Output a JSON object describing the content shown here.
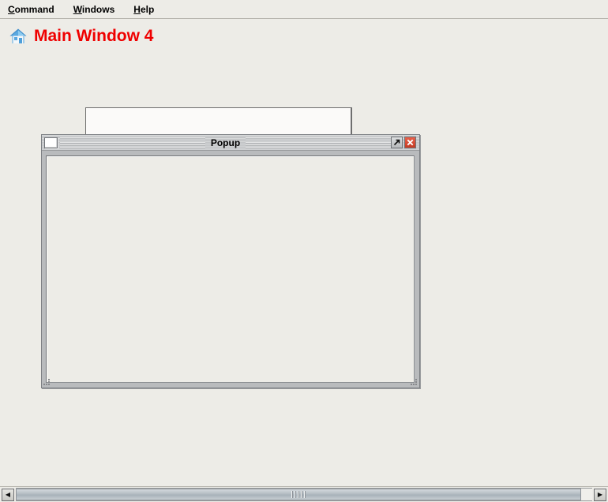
{
  "menubar": {
    "items": [
      {
        "label": "Command",
        "mnemonic": "C",
        "rest": "ommand",
        "name": "menu-command"
      },
      {
        "label": "Windows",
        "mnemonic": "W",
        "rest": "indows",
        "name": "menu-windows"
      },
      {
        "label": "Help",
        "mnemonic": "H",
        "rest": "elp",
        "name": "menu-help"
      }
    ]
  },
  "main_window": {
    "title": "Main Window 4",
    "title_color": "#ef0000",
    "icon": "home-icon",
    "background_color": "#edece7"
  },
  "background_panel": {
    "visible_fragment": true,
    "background_color": "#fbfaf9",
    "border_color": "#6e6e6e",
    "red_marks": [
      {
        "label": "",
        "color": "#e01b18"
      },
      {
        "label": "",
        "color": "#e01b18"
      }
    ]
  },
  "popup_window": {
    "title": "Popup",
    "menu_button_icon": "window-menu-icon",
    "maximize_button_icon": "maximize-arrow-icon",
    "close_button_icon": "close-x-icon",
    "close_button_color": "#c33a22",
    "content": "",
    "content_background": "#edece7",
    "frame_color": "#b9bbbd"
  },
  "scrollbar": {
    "left_arrow_glyph": "◀",
    "right_arrow_glyph": "▶",
    "thumb_grip_icon": "grip-lines-icon",
    "orientation": "horizontal"
  }
}
